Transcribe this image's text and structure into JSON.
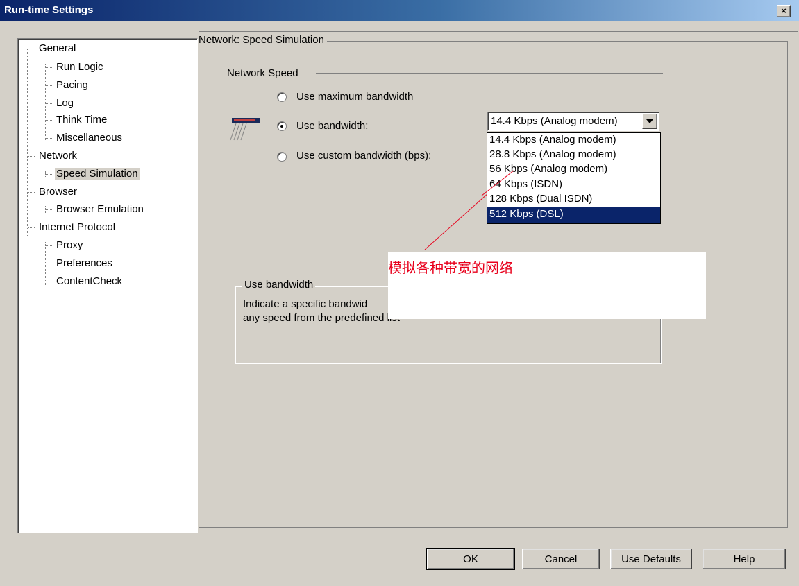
{
  "window": {
    "title": "Run-time Settings",
    "close_glyph": "×"
  },
  "tree": [
    {
      "label": "General",
      "level": 0
    },
    {
      "label": "Run Logic",
      "level": 1
    },
    {
      "label": "Pacing",
      "level": 1
    },
    {
      "label": "Log",
      "level": 1
    },
    {
      "label": "Think Time",
      "level": 1
    },
    {
      "label": "Miscellaneous",
      "level": 1
    },
    {
      "label": "Network",
      "level": 0
    },
    {
      "label": "Speed Simulation",
      "level": 1,
      "selected": true
    },
    {
      "label": "Browser",
      "level": 0
    },
    {
      "label": "Browser Emulation",
      "level": 1
    },
    {
      "label": "Internet Protocol",
      "level": 0
    },
    {
      "label": "Proxy",
      "level": 1
    },
    {
      "label": "Preferences",
      "level": 1
    },
    {
      "label": "ContentCheck",
      "level": 1
    }
  ],
  "panel": {
    "header": "Network: Speed Simulation",
    "section": "Network Speed",
    "radios": {
      "max": "Use maximum bandwidth",
      "bandwidth": "Use bandwidth:",
      "custom": "Use custom bandwidth (bps):",
      "selected": "bandwidth"
    },
    "combo": {
      "value": "14.4 Kbps (Analog modem)",
      "options": [
        "14.4 Kbps (Analog modem)",
        "28.8 Kbps (Analog modem)",
        "56 Kbps (Analog modem)",
        "64 Kbps (ISDN)",
        "128 Kbps (Dual ISDN)",
        "512 Kbps (DSL)"
      ],
      "highlighted_index": 5
    },
    "groupbox": {
      "title": "Use bandwidth",
      "line1": "Indicate a specific bandwid",
      "line2": "any speed from the predefined list"
    }
  },
  "annotation": {
    "text": "模拟各种带宽的网络",
    "color": "#e8001c"
  },
  "buttons": {
    "ok": "OK",
    "cancel": "Cancel",
    "defaults": "Use Defaults",
    "help": "Help"
  },
  "icons": {
    "network": "network-card-icon",
    "close": "close-icon"
  }
}
